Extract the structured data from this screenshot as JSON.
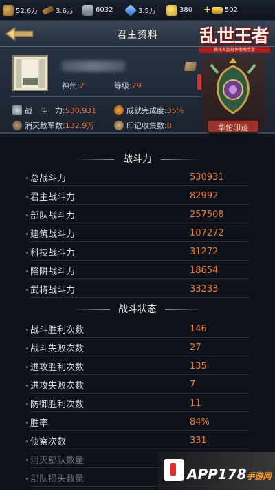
{
  "resources": [
    {
      "icon": "food-icon",
      "value": "52.6万"
    },
    {
      "icon": "wood-icon",
      "value": "3.6万"
    },
    {
      "icon": "stone-icon",
      "value": "6032"
    },
    {
      "icon": "iron-icon",
      "value": "3.5万"
    },
    {
      "icon": "coin-icon",
      "value": "380"
    },
    {
      "icon": "gold-icon",
      "value": "502"
    }
  ],
  "header": {
    "title": "君主资料"
  },
  "logo": {
    "text": "乱世王者",
    "subtitle": "腾讯首款战争策略手游"
  },
  "profile": {
    "region_label": "神州:",
    "region_value": "2",
    "level_label": "等级:",
    "level_value": "29",
    "power_label": "战　斗　力:",
    "power_value": "530,931",
    "kills_label": "消灭敌军数:",
    "kills_value": "132.9万",
    "achievement_label": "成就完成度:",
    "achievement_value": "35%",
    "seal_label": "印记收集数:",
    "seal_value": "8",
    "emblem_label": "华佗印迹"
  },
  "sections": [
    {
      "title": "战斗力",
      "rows": [
        {
          "label": "总战斗力",
          "value": "530931"
        },
        {
          "label": "君主战斗力",
          "value": "82992"
        },
        {
          "label": "部队战斗力",
          "value": "257508"
        },
        {
          "label": "建筑战斗力",
          "value": "107272"
        },
        {
          "label": "科技战斗力",
          "value": "31272"
        },
        {
          "label": "陷阱战斗力",
          "value": "18654"
        },
        {
          "label": "武将战斗力",
          "value": "33233"
        }
      ]
    },
    {
      "title": "战斗状态",
      "rows": [
        {
          "label": "战斗胜利次数",
          "value": "146"
        },
        {
          "label": "战斗失败次数",
          "value": "27"
        },
        {
          "label": "进攻胜利次数",
          "value": "135"
        },
        {
          "label": "进攻失败次数",
          "value": "7"
        },
        {
          "label": "防御胜利次数",
          "value": "11"
        },
        {
          "label": "胜率",
          "value": "84%"
        },
        {
          "label": "侦察次数",
          "value": "331"
        },
        {
          "label": "消灭部队数量",
          "value": ""
        },
        {
          "label": "部队损失数量",
          "value": ""
        }
      ]
    }
  ],
  "watermark": {
    "text": "APP178",
    "sub": "手游网"
  }
}
